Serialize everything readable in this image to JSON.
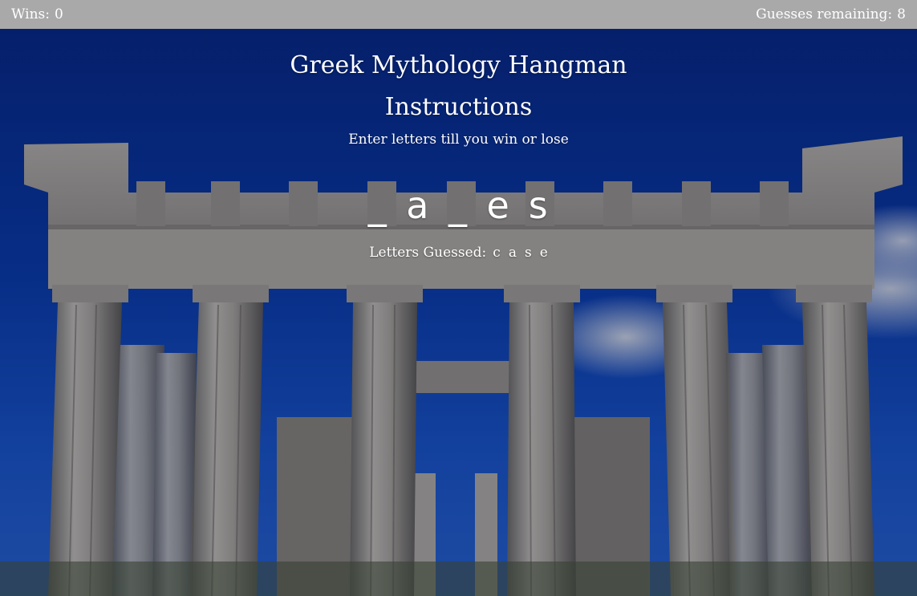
{
  "header": {
    "wins_label": "Wins:",
    "wins_value": "0",
    "guesses_label": "Guesses remaining:",
    "guesses_value": "8"
  },
  "main": {
    "title": "Greek Mythology Hangman",
    "subtitle": "Instructions",
    "instructions": "Enter letters till you win or lose",
    "word": [
      "_",
      "a",
      "_",
      "e",
      "s"
    ],
    "guessed_label": "Letters Guessed:",
    "guessed_letters": [
      "c",
      "a",
      "s",
      "e"
    ]
  },
  "colors": {
    "topbar": "#a9a9a9",
    "text": "#ffffff",
    "sky": "#0a3fb0"
  }
}
